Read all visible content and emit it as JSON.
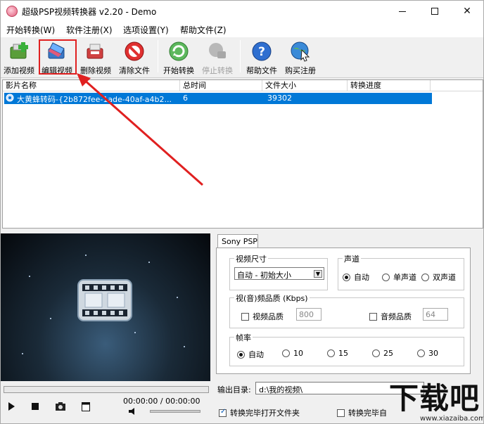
{
  "window": {
    "title": "超级PSP视频转换器 v2.20 - Demo",
    "controls": {
      "minimize": "—",
      "maximize": "□",
      "close": "✕"
    }
  },
  "menu": [
    "开始转换(W)",
    "软件注册(X)",
    "选项设置(Y)",
    "帮助文件(Z)"
  ],
  "toolbar": {
    "add": "添加视频",
    "edit": "编辑视频",
    "delete": "删除视频",
    "clear": "清除文件",
    "start": "开始转换",
    "stop": "停止转换",
    "help": "帮助文件",
    "buy": "购买注册"
  },
  "list": {
    "columns": [
      "影片名称",
      "总时间",
      "文件大小",
      "转换进度"
    ],
    "rows": [
      {
        "name": "大黄蜂转码-{2b872fee-1ade-40af-a4b2...",
        "duration": "6",
        "size": "39302",
        "progress": ""
      }
    ]
  },
  "player": {
    "time": "00:00:00 / 00:00:00"
  },
  "settings": {
    "tab": "Sony PSP",
    "video_size": {
      "label": "视频尺寸",
      "value": "自动 - 初始大小"
    },
    "audio_channel": {
      "label": "声道",
      "options": [
        "自动",
        "单声道",
        "双声道"
      ],
      "selected": "自动"
    },
    "quality": {
      "label": "视(音)频品质 (Kbps)",
      "video_label": "视频品质",
      "video_value": "800",
      "audio_label": "音频品质",
      "audio_value": "64"
    },
    "framerate": {
      "label": "帧率",
      "options": [
        "自动",
        "10",
        "15",
        "25",
        "30"
      ],
      "selected": "自动"
    }
  },
  "output": {
    "label": "输出目录:",
    "path": "d:\\我的视频\\",
    "open_after": "转换完毕打开文件夹",
    "after2": "转换完毕自"
  },
  "watermark": {
    "text": "下载吧",
    "site": "www.xiazaiba.com"
  },
  "colors": {
    "selection": "#0078d7",
    "annotation": "#e02020"
  }
}
